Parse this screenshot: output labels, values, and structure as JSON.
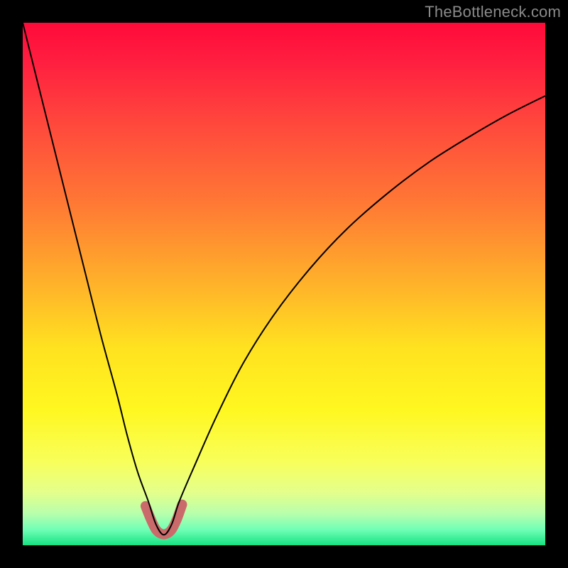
{
  "watermark": "TheBottleneck.com",
  "colors": {
    "frame": "#000000",
    "curve": "#000000",
    "accent": "#cb6a6a",
    "gradient_stops": [
      {
        "offset": 0.0,
        "color": "#ff0a3a"
      },
      {
        "offset": 0.08,
        "color": "#ff2040"
      },
      {
        "offset": 0.2,
        "color": "#ff4a3c"
      },
      {
        "offset": 0.35,
        "color": "#ff7a34"
      },
      {
        "offset": 0.5,
        "color": "#ffb22a"
      },
      {
        "offset": 0.62,
        "color": "#ffe120"
      },
      {
        "offset": 0.74,
        "color": "#fff720"
      },
      {
        "offset": 0.84,
        "color": "#f8ff5a"
      },
      {
        "offset": 0.9,
        "color": "#e3ff8c"
      },
      {
        "offset": 0.94,
        "color": "#b7ffac"
      },
      {
        "offset": 0.97,
        "color": "#70ffb5"
      },
      {
        "offset": 1.0,
        "color": "#17e283"
      }
    ]
  },
  "chart_data": {
    "type": "line",
    "title": "",
    "xlabel": "",
    "ylabel": "",
    "xlim": [
      0,
      1
    ],
    "ylim": [
      0,
      1
    ],
    "minimum_x": 0.27,
    "series": [
      {
        "name": "bottleneck-curve",
        "x": [
          0.0,
          0.03,
          0.06,
          0.09,
          0.12,
          0.15,
          0.18,
          0.2,
          0.22,
          0.24,
          0.255,
          0.27,
          0.285,
          0.3,
          0.33,
          0.37,
          0.42,
          0.48,
          0.55,
          0.62,
          0.7,
          0.78,
          0.86,
          0.93,
          1.0
        ],
        "y": [
          1.0,
          0.88,
          0.76,
          0.64,
          0.52,
          0.4,
          0.29,
          0.21,
          0.14,
          0.085,
          0.04,
          0.02,
          0.04,
          0.085,
          0.155,
          0.245,
          0.345,
          0.44,
          0.53,
          0.605,
          0.675,
          0.735,
          0.785,
          0.825,
          0.86
        ]
      },
      {
        "name": "sweet-spot-highlight",
        "x": [
          0.235,
          0.245,
          0.255,
          0.265,
          0.275,
          0.285,
          0.295,
          0.305
        ],
        "y": [
          0.075,
          0.05,
          0.03,
          0.022,
          0.022,
          0.03,
          0.05,
          0.078
        ]
      }
    ]
  }
}
